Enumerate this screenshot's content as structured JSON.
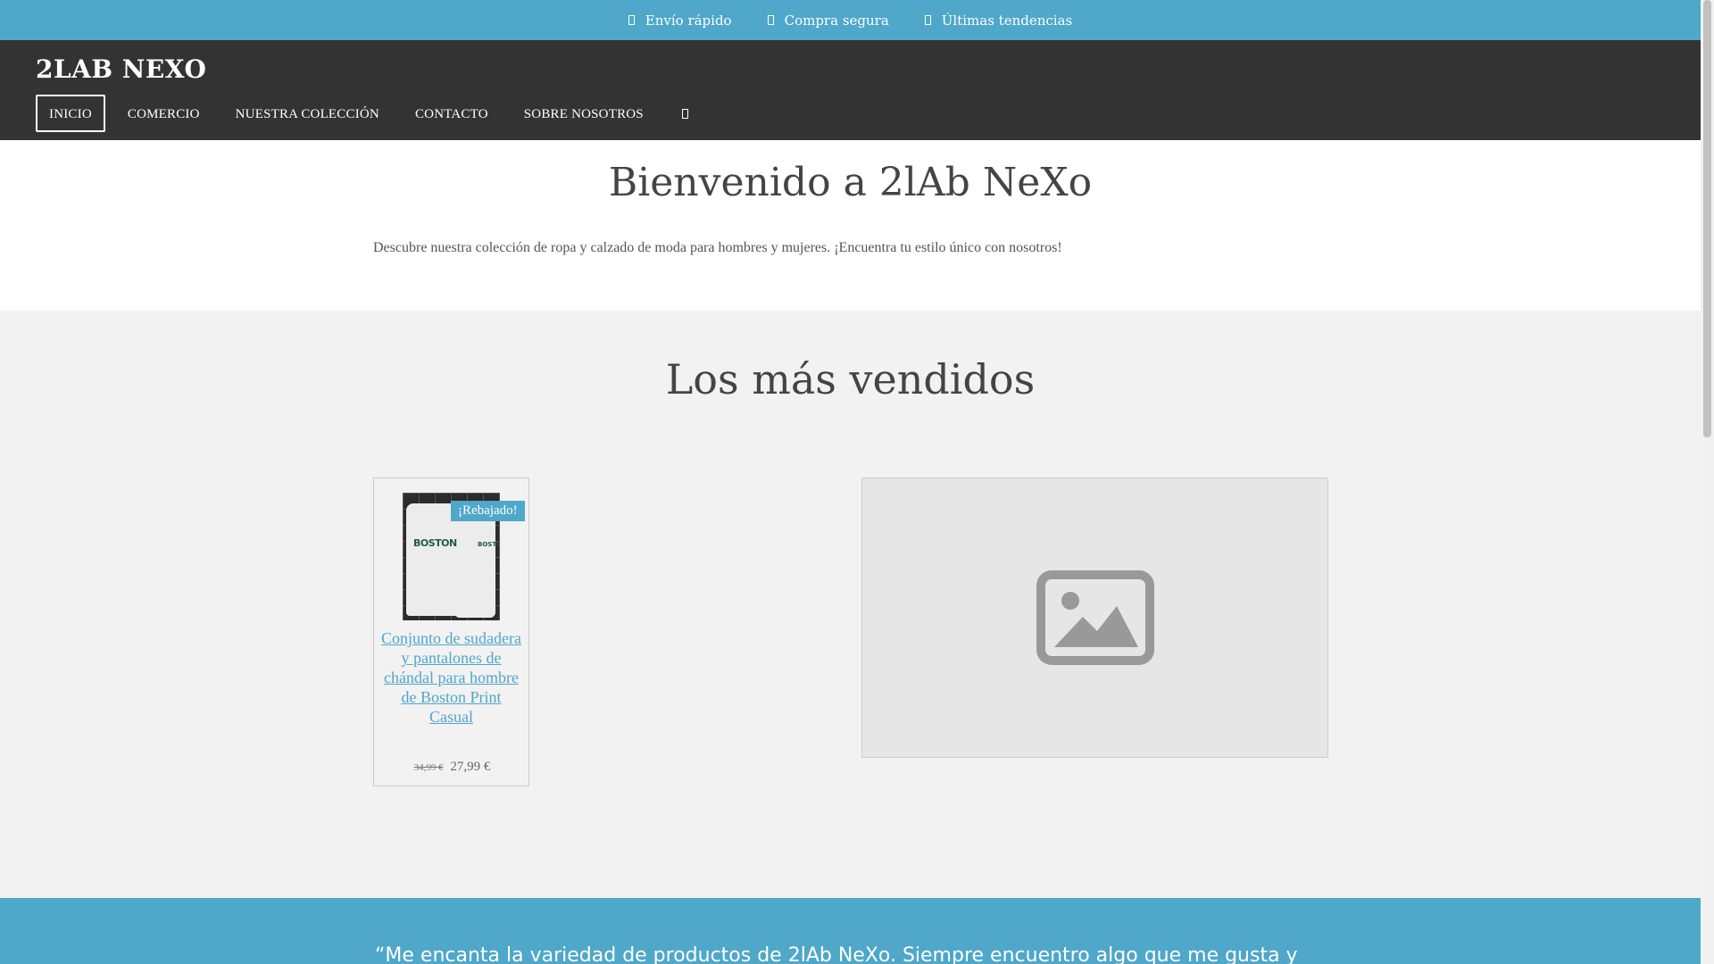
{
  "topbar": {
    "items": [
      {
        "icon": "truck-icon",
        "label": "Envío rápido"
      },
      {
        "icon": "lock-icon",
        "label": "Compra segura"
      },
      {
        "icon": "star-icon",
        "label": "Últimas tendencias"
      }
    ]
  },
  "header": {
    "brand": "2LAB NEXO",
    "nav": [
      {
        "label": "INICIO",
        "active": true
      },
      {
        "label": "COMERCIO"
      },
      {
        "label": "NUESTRA COLECCIÓN"
      },
      {
        "label": "CONTACTO"
      },
      {
        "label": "SOBRE NOSOTROS"
      }
    ],
    "search_icon": "search-icon"
  },
  "welcome": {
    "title": "Bienvenido a 2lAb NeXo",
    "text": "Descubre nuestra colección de ropa y calzado de moda para hombres y mujeres. ¡Encuentra tu estilo único con nosotros!"
  },
  "bestsellers": {
    "title": "Los más vendidos",
    "product": {
      "badge": "¡Rebajado!",
      "title": "Conjunto de sudadera y pantalones de chándal para hombre de Boston Print Casual",
      "old_price": "34,99 €",
      "price": "27,99 €",
      "image_print": "BOSTON"
    },
    "placeholder_icon": "image-placeholder-icon"
  },
  "testimonial": {
    "text": "“Me encanta la variedad de productos de 2lAb NeXo. Siempre encuentro algo que me gusta y"
  },
  "colors": {
    "accent": "#4fa7c9",
    "header_bg": "#333333",
    "section_bg": "#f2f2f2"
  }
}
